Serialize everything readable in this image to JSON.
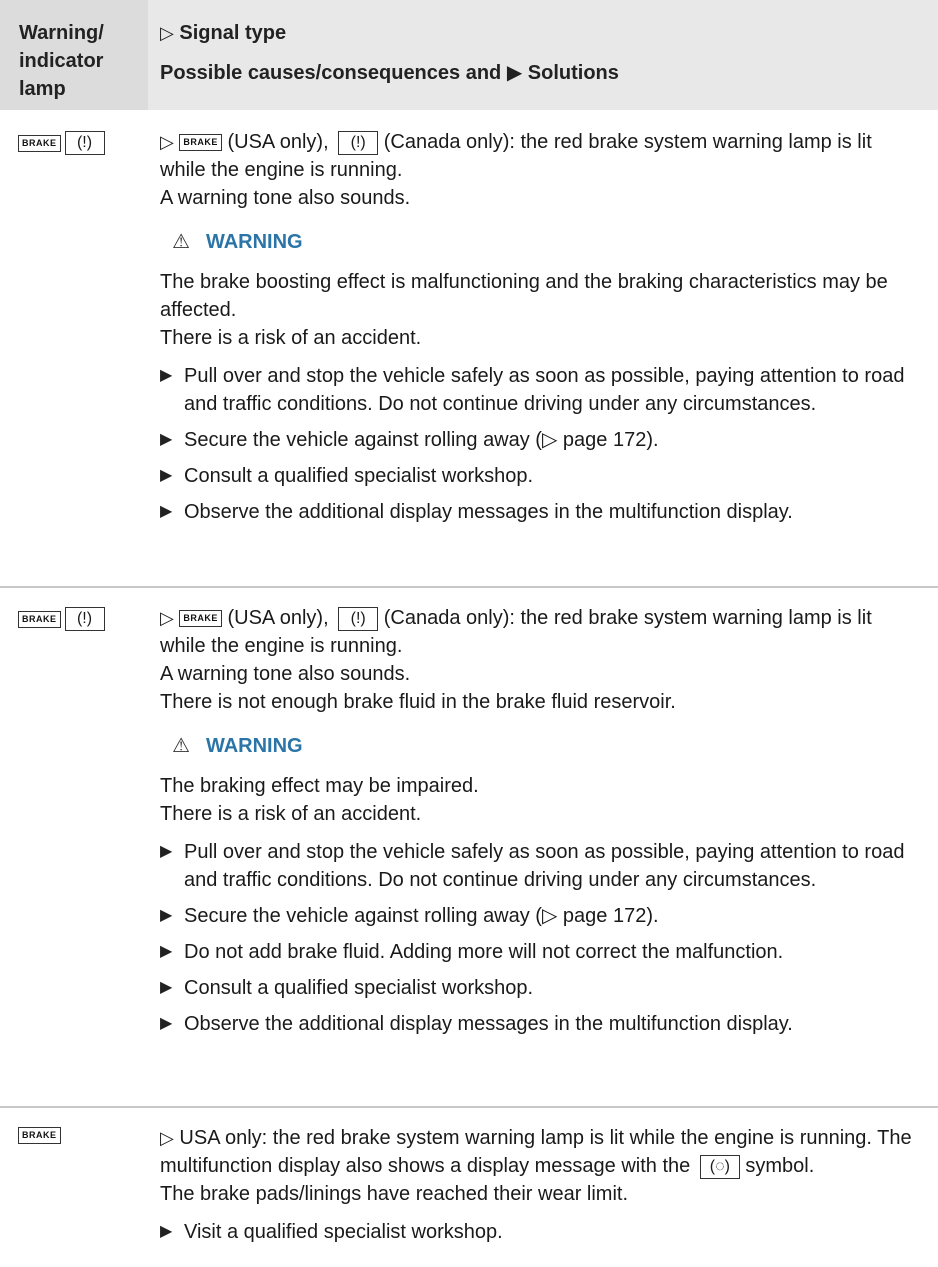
{
  "header": {
    "col1": [
      "Warning/",
      "indicator",
      "lamp"
    ],
    "signal_type": "Signal type",
    "causes_solutions": "Possible causes/consequences and",
    "solutions": "Solutions"
  },
  "lamps": {
    "brake": "BRAKE"
  },
  "rows": [
    {
      "intro": [
        "(USA only),",
        "(Canada only): the red brake system warning lamp is lit while the engine is running."
      ],
      "lines_before_warning": [
        "A warning tone also sounds."
      ],
      "warning_title": "WARNING",
      "warning_lines": [
        "The brake boosting effect is malfunctioning and the braking characteristics may be affected.",
        "There is a risk of an accident."
      ],
      "bullets": [
        "Pull over and stop the vehicle safely as soon as possible, paying attention to road and traffic conditions. Do not continue driving under any circumstances.",
        "Secure the vehicle against rolling away (▷ page 172).",
        "Consult a qualified specialist workshop.",
        "Observe the additional display messages in the multifunction display."
      ]
    },
    {
      "intro": [
        "(USA only),",
        "(Canada only): the red brake system warning lamp is lit while the engine is running."
      ],
      "lines_before_warning": [
        "A warning tone also sounds.",
        "There is not enough brake fluid in the brake fluid reservoir."
      ],
      "warning_title": "WARNING",
      "warning_lines": [
        "The braking effect may be impaired.",
        "There is a risk of an accident."
      ],
      "bullets": [
        "Pull over and stop the vehicle safely as soon as possible, paying attention to road and traffic conditions. Do not continue driving under any circumstances.",
        "Secure the vehicle against rolling away (▷ page 172).",
        "Do not add brake fluid. Adding more will not correct the malfunction.",
        "Consult a qualified specialist workshop.",
        "Observe the additional display messages in the multifunction display."
      ]
    },
    {
      "intro": [
        "USA only: the red brake system warning lamp is lit while the engine is running. The multifunction display also shows a display message with the",
        "symbol."
      ],
      "lines": [
        "The brake pads/linings have reached their wear limit."
      ],
      "bullets": [
        "Visit a qualified specialist workshop."
      ]
    }
  ]
}
